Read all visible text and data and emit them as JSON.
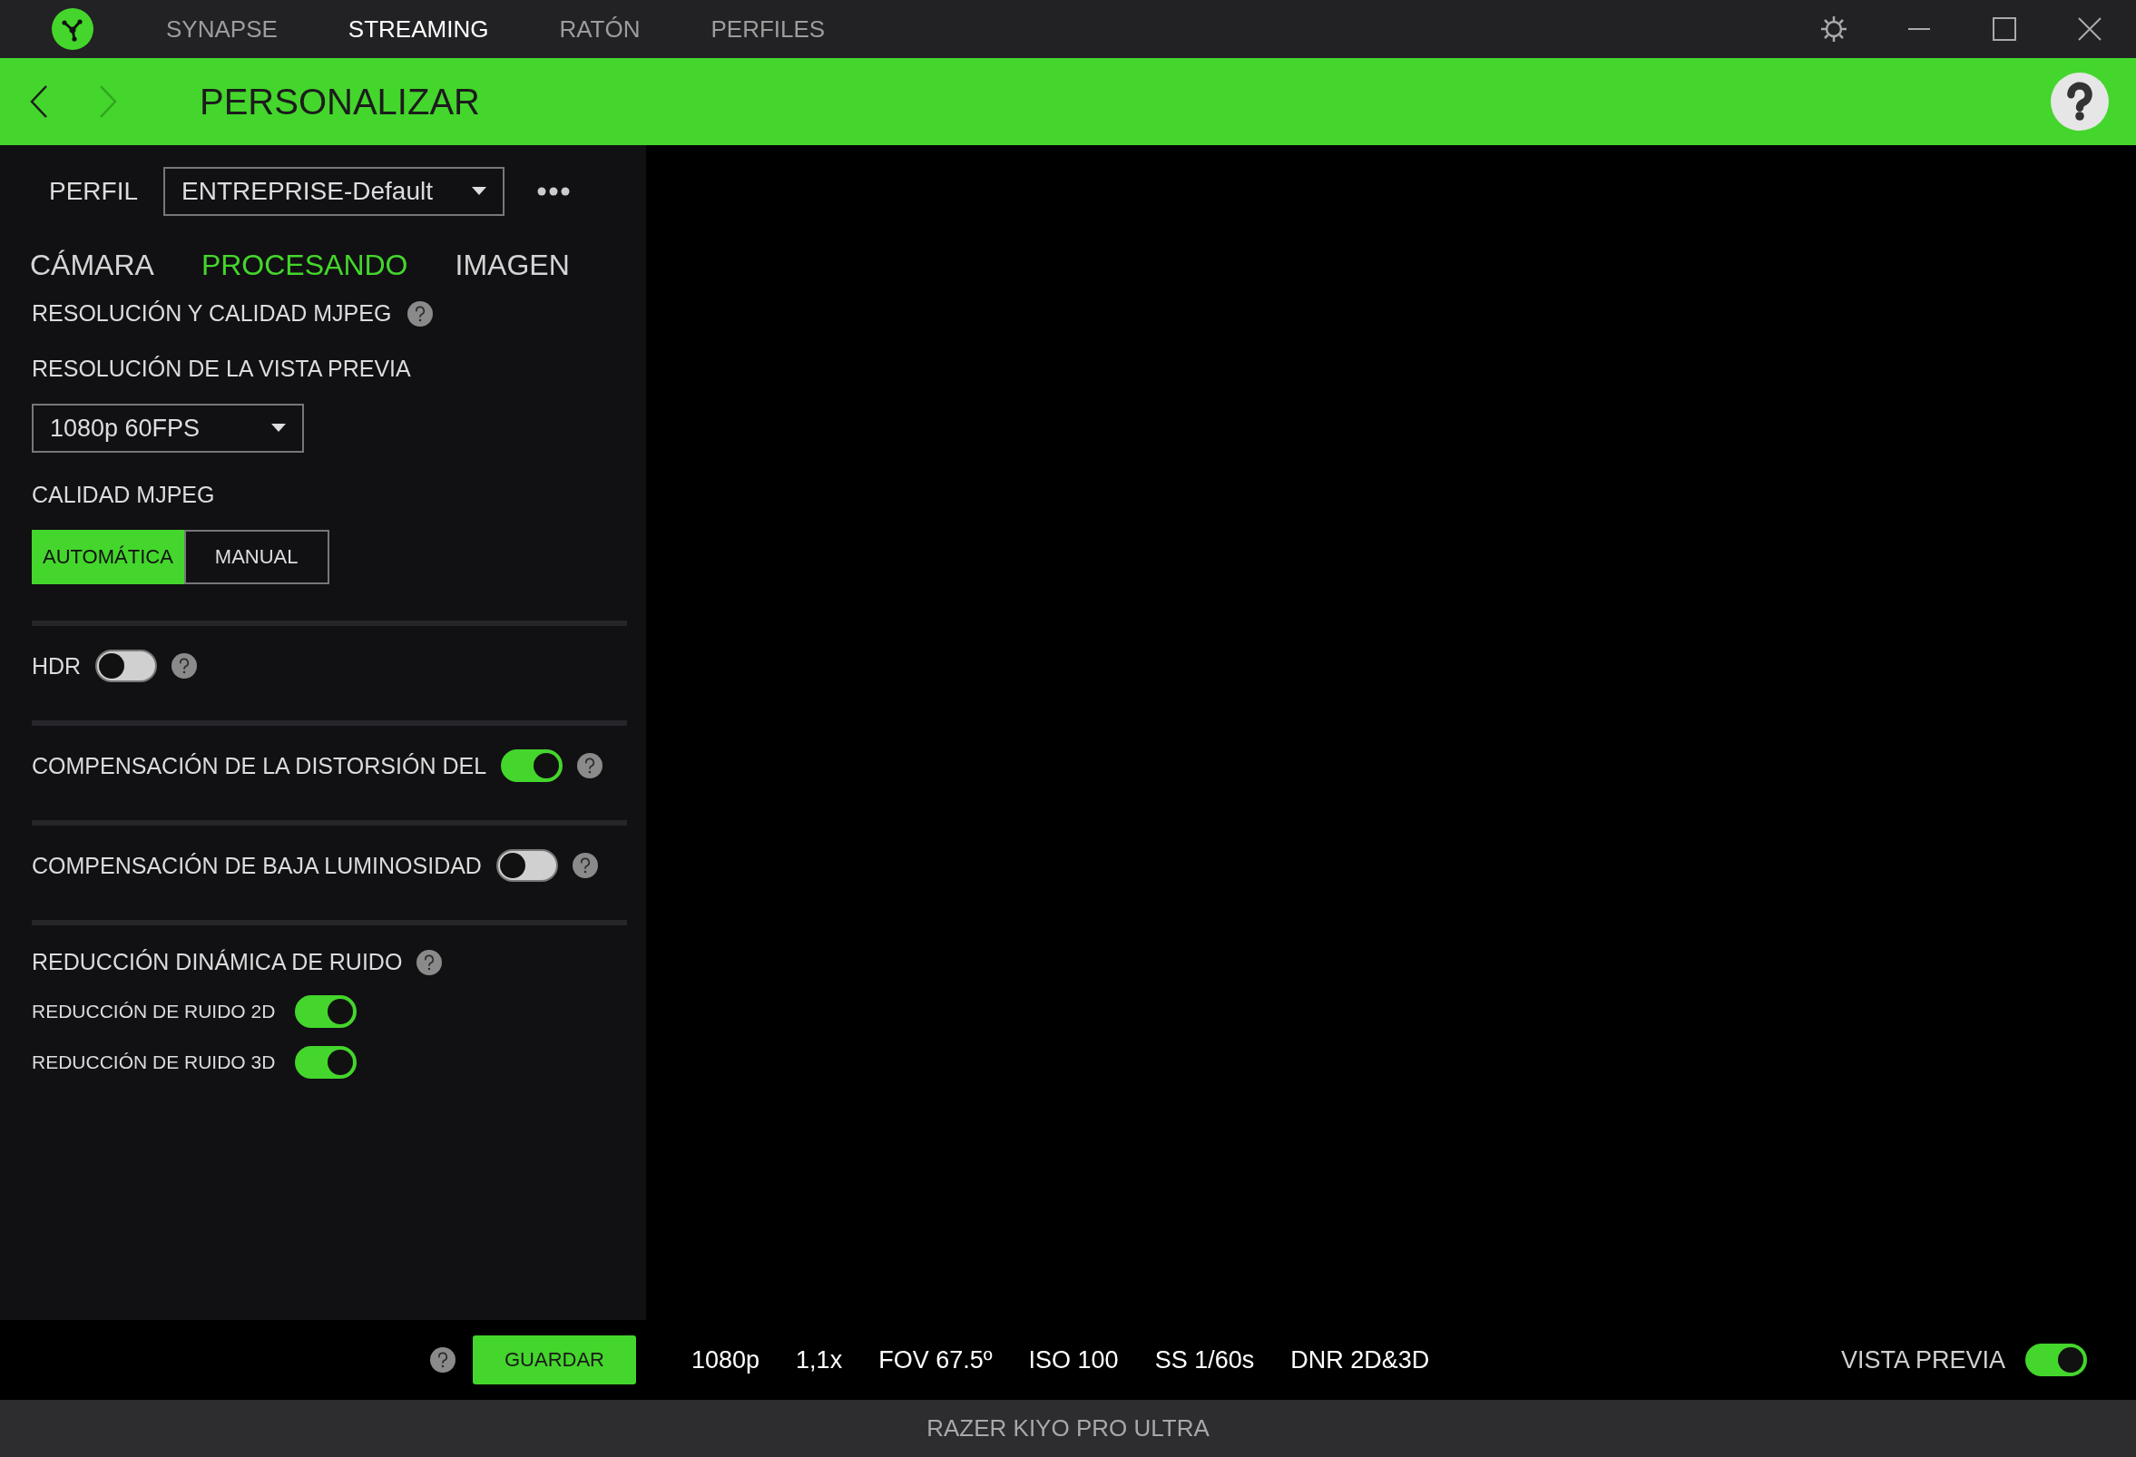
{
  "nav_tabs": [
    {
      "label": "SYNAPSE",
      "selected": false
    },
    {
      "label": "STREAMING",
      "selected": true
    },
    {
      "label": "RATÓN",
      "selected": false
    },
    {
      "label": "PERFILES",
      "selected": false
    }
  ],
  "header": {
    "title": "PERSONALIZAR"
  },
  "profile": {
    "label": "PERFIL",
    "value": "ENTREPRISE-Default"
  },
  "tabs": [
    {
      "label": "CÁMARA",
      "selected": false
    },
    {
      "label": "PROCESANDO",
      "selected": true
    },
    {
      "label": "IMAGEN",
      "selected": false
    }
  ],
  "section_title": "RESOLUCIÓN Y CALIDAD MJPEG",
  "preview_resolution": {
    "label": "RESOLUCIÓN DE LA VISTA PREVIA",
    "value": "1080p 60FPS"
  },
  "mjpeg_quality": {
    "label": "CALIDAD MJPEG",
    "options": [
      {
        "label": "AUTOMÁTICA",
        "selected": true
      },
      {
        "label": "MANUAL",
        "selected": false
      }
    ]
  },
  "settings": [
    {
      "kind": "toggle",
      "label": "HDR",
      "on": false
    },
    {
      "kind": "toggle",
      "label": "COMPENSACIÓN DE LA DISTORSIÓN DEL",
      "on": true
    },
    {
      "kind": "toggle",
      "label": "COMPENSACIÓN DE BAJA LUMINOSIDAD",
      "on": false
    },
    {
      "kind": "group",
      "label": "REDUCCIÓN DINÁMICA DE RUIDO",
      "children": [
        {
          "label": "REDUCCIÓN DE RUIDO 2D",
          "on": true
        },
        {
          "label": "REDUCCIÓN DE RUIDO 3D",
          "on": true
        }
      ]
    }
  ],
  "save_button": "GUARDAR",
  "stats": [
    "1080p",
    "1,1x",
    "FOV 67.5º",
    "ISO 100",
    "SS 1/60s",
    "DNR 2D&3D"
  ],
  "preview_toggle": {
    "label": "VISTA PREVIA",
    "on": true
  },
  "device_name": "RAZER KIYO PRO ULTRA"
}
